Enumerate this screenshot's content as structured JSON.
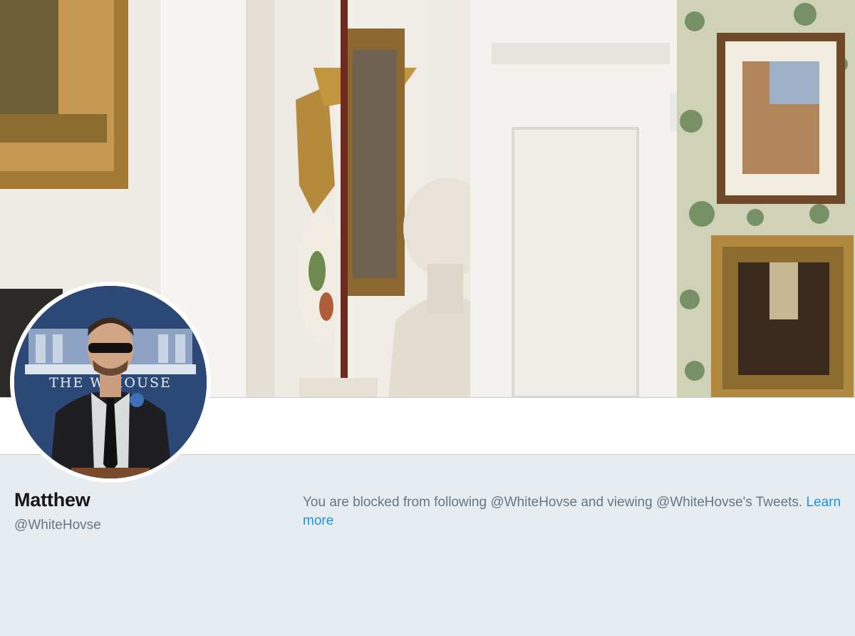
{
  "header": {
    "banner_alt": "profile header photo"
  },
  "profile": {
    "name": "Matthew",
    "handle": "@WhiteHovse",
    "avatar_sign_text": "THE W    HOUSE"
  },
  "notice": {
    "text": "You are blocked from following @WhiteHovse and viewing @WhiteHovse's Tweets.",
    "link_label": "Learn more"
  },
  "colors": {
    "background": "#e6ecf0",
    "link": "#1b95e0",
    "name": "#14171a",
    "muted": "#657786"
  }
}
